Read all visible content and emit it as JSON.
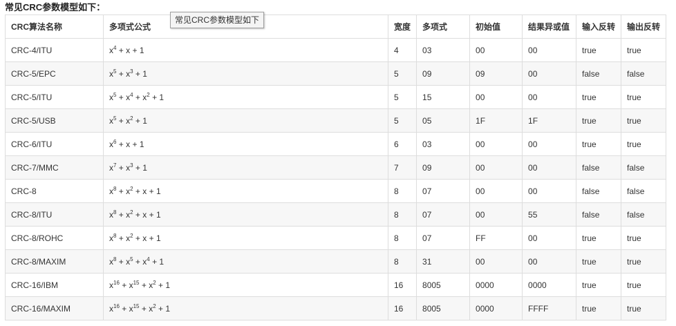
{
  "title": "常见CRC参数模型如下：",
  "tooltip": "常见CRC参数模型如下",
  "columns": [
    "CRC算法名称",
    "多项式公式",
    "宽度",
    "多项式",
    "初始值",
    "结果异或值",
    "输入反转",
    "输出反转"
  ],
  "rows": [
    {
      "name": "CRC-4/ITU",
      "formula": [
        [
          "x",
          "4"
        ],
        [
          "x",
          ""
        ],
        [
          "1",
          ""
        ]
      ],
      "width": "4",
      "poly": "03",
      "init": "00",
      "xorout": "00",
      "refin": "true",
      "refout": "true"
    },
    {
      "name": "CRC-5/EPC",
      "formula": [
        [
          "x",
          "5"
        ],
        [
          "x",
          "3"
        ],
        [
          "1",
          ""
        ]
      ],
      "width": "5",
      "poly": "09",
      "init": "09",
      "xorout": "00",
      "refin": "false",
      "refout": "false"
    },
    {
      "name": "CRC-5/ITU",
      "formula": [
        [
          "x",
          "5"
        ],
        [
          "x",
          "4"
        ],
        [
          "x",
          "2"
        ],
        [
          "1",
          ""
        ]
      ],
      "width": "5",
      "poly": "15",
      "init": "00",
      "xorout": "00",
      "refin": "true",
      "refout": "true"
    },
    {
      "name": "CRC-5/USB",
      "formula": [
        [
          "x",
          "5"
        ],
        [
          "x",
          "2"
        ],
        [
          "1",
          ""
        ]
      ],
      "width": "5",
      "poly": "05",
      "init": "1F",
      "xorout": "1F",
      "refin": "true",
      "refout": "true"
    },
    {
      "name": "CRC-6/ITU",
      "formula": [
        [
          "x",
          "6"
        ],
        [
          "x",
          ""
        ],
        [
          "1",
          ""
        ]
      ],
      "width": "6",
      "poly": "03",
      "init": "00",
      "xorout": "00",
      "refin": "true",
      "refout": "true"
    },
    {
      "name": "CRC-7/MMC",
      "formula": [
        [
          "x",
          "7"
        ],
        [
          "x",
          "3"
        ],
        [
          "1",
          ""
        ]
      ],
      "width": "7",
      "poly": "09",
      "init": "00",
      "xorout": "00",
      "refin": "false",
      "refout": "false"
    },
    {
      "name": "CRC-8",
      "formula": [
        [
          "x",
          "8"
        ],
        [
          "x",
          "2"
        ],
        [
          "x",
          ""
        ],
        [
          "1",
          ""
        ]
      ],
      "width": "8",
      "poly": "07",
      "init": "00",
      "xorout": "00",
      "refin": "false",
      "refout": "false"
    },
    {
      "name": "CRC-8/ITU",
      "formula": [
        [
          "x",
          "8"
        ],
        [
          "x",
          "2"
        ],
        [
          "x",
          ""
        ],
        [
          "1",
          ""
        ]
      ],
      "width": "8",
      "poly": "07",
      "init": "00",
      "xorout": "55",
      "refin": "false",
      "refout": "false"
    },
    {
      "name": "CRC-8/ROHC",
      "formula": [
        [
          "x",
          "8"
        ],
        [
          "x",
          "2"
        ],
        [
          "x",
          ""
        ],
        [
          "1",
          ""
        ]
      ],
      "width": "8",
      "poly": "07",
      "init": "FF",
      "xorout": "00",
      "refin": "true",
      "refout": "true"
    },
    {
      "name": "CRC-8/MAXIM",
      "formula": [
        [
          "x",
          "8"
        ],
        [
          "x",
          "5"
        ],
        [
          "x",
          "4"
        ],
        [
          "1",
          ""
        ]
      ],
      "width": "8",
      "poly": "31",
      "init": "00",
      "xorout": "00",
      "refin": "true",
      "refout": "true"
    },
    {
      "name": "CRC-16/IBM",
      "formula": [
        [
          "x",
          "16"
        ],
        [
          "x",
          "15"
        ],
        [
          "x",
          "2"
        ],
        [
          "1",
          ""
        ]
      ],
      "width": "16",
      "poly": "8005",
      "init": "0000",
      "xorout": "0000",
      "refin": "true",
      "refout": "true"
    },
    {
      "name": "CRC-16/MAXIM",
      "formula": [
        [
          "x",
          "16"
        ],
        [
          "x",
          "15"
        ],
        [
          "x",
          "2"
        ],
        [
          "1",
          ""
        ]
      ],
      "width": "16",
      "poly": "8005",
      "init": "0000",
      "xorout": "FFFF",
      "refin": "true",
      "refout": "true"
    }
  ]
}
